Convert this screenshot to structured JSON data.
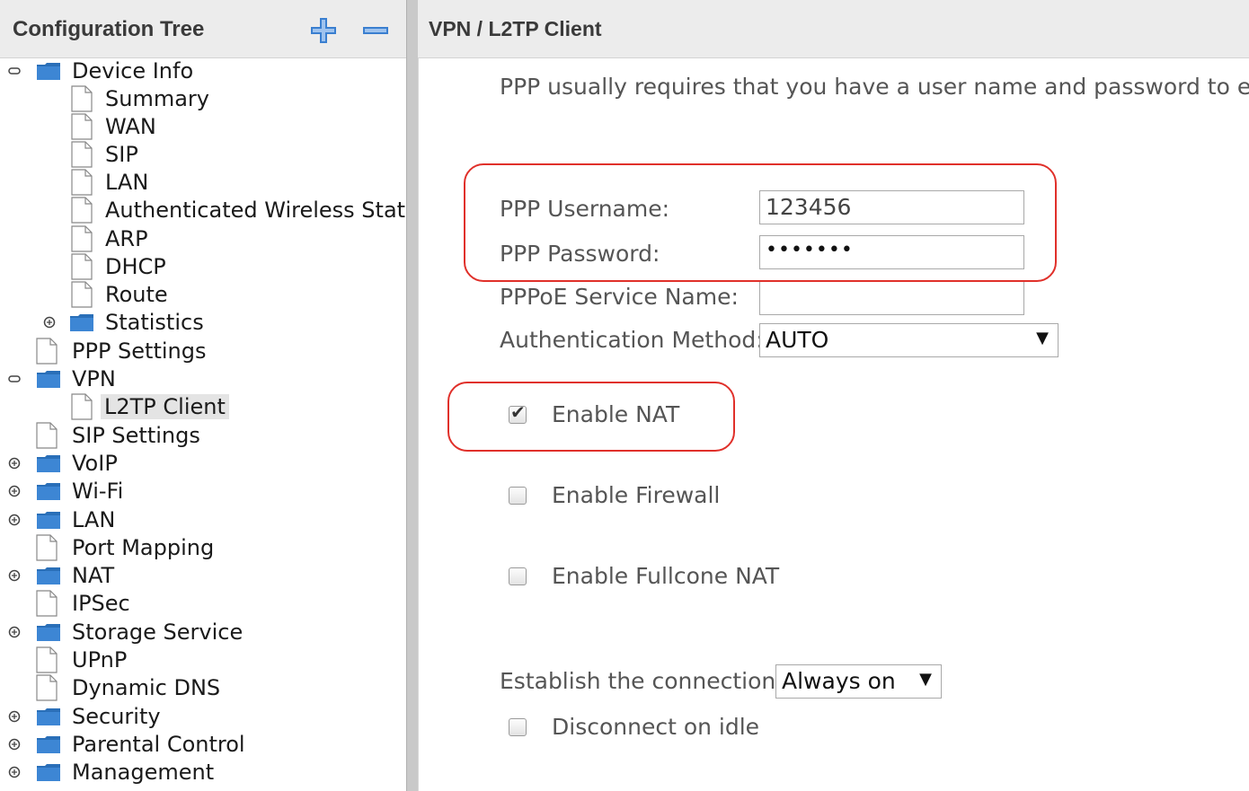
{
  "tree": {
    "title": "Configuration Tree",
    "items": [
      {
        "label": "Device Info"
      },
      {
        "label": "Summary"
      },
      {
        "label": "WAN"
      },
      {
        "label": "SIP"
      },
      {
        "label": "LAN"
      },
      {
        "label": "Authenticated Wireless Statior"
      },
      {
        "label": "ARP"
      },
      {
        "label": "DHCP"
      },
      {
        "label": "Route"
      },
      {
        "label": "Statistics"
      },
      {
        "label": "PPP Settings"
      },
      {
        "label": "VPN"
      },
      {
        "label": "L2TP Client"
      },
      {
        "label": "SIP Settings"
      },
      {
        "label": "VoIP"
      },
      {
        "label": "Wi-Fi"
      },
      {
        "label": "LAN"
      },
      {
        "label": "Port Mapping"
      },
      {
        "label": "NAT"
      },
      {
        "label": "IPSec"
      },
      {
        "label": "Storage Service"
      },
      {
        "label": "UPnP"
      },
      {
        "label": "Dynamic DNS"
      },
      {
        "label": "Security"
      },
      {
        "label": "Parental Control"
      },
      {
        "label": "Management"
      }
    ]
  },
  "panel": {
    "title": "VPN / L2TP Client",
    "intro": "PPP usually requires that you have a user name and password to esta",
    "username_label": "PPP Username:",
    "username_value": "123456",
    "password_label": "PPP Password:",
    "password_mask": "•••••••",
    "service_label": "PPPoE Service Name:",
    "service_value": "",
    "auth_label": "Authentication Method:",
    "auth_value": "AUTO",
    "enable_nat": "Enable NAT",
    "enable_firewall": "Enable Firewall",
    "enable_fullcone": "Enable Fullcone NAT",
    "establish_label": "Establish the connection:",
    "establish_value": "Always on",
    "disconnect_idle": "Disconnect on idle"
  },
  "state": {
    "enable_nat_checked": true,
    "enable_firewall_checked": false,
    "enable_fullcone_checked": false,
    "disconnect_idle_checked": false,
    "selected_item": "L2TP Client"
  },
  "colors": {
    "highlight": "#e0302a",
    "folder": "#2a6fb8",
    "header_bg": "#ececec"
  }
}
